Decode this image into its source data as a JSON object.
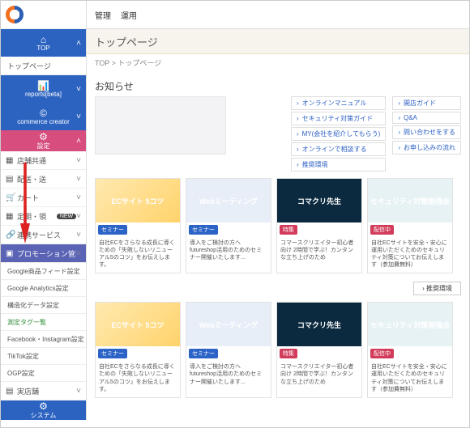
{
  "topbar": {
    "t1": "管理",
    "t2": "運用"
  },
  "page": {
    "title": "トップページ",
    "crumb": "TOP > トップページ"
  },
  "sidebar": {
    "logo": "F",
    "logoText": "",
    "top": "TOP",
    "toppage": "トップページ",
    "reports": "reports[beta]",
    "commerce": "commerce creator",
    "settings": "設定",
    "gray": [
      "店舗共通",
      "配送・送",
      "カート",
      "定期・領",
      "連携サービス"
    ],
    "badge": "NEW",
    "promo": "プロモーション管理",
    "subs": [
      "Google商品フィード設定",
      "Google Analytics設定",
      "構造化データ設定",
      "測定タグ一覧",
      "Facebook・Instagram設定",
      "TikTok設定",
      "OGP設定"
    ],
    "store": "実店舗",
    "system": "システム"
  },
  "notice": {
    "title": "お知らせ"
  },
  "links1": [
    "オンラインマニュアル",
    "セキュリティ対策ガイド",
    "MY(会社を紹介してもらう)",
    "オンラインで相談する",
    "推奨環境"
  ],
  "links2": [
    "開店ガイド",
    "Q&A",
    "問い合わせをする",
    "お申し込みの流れ"
  ],
  "cards": [
    {
      "thumb": "ECサイト 5コツ",
      "chip": "セミナー",
      "chipCls": "sem",
      "desc": "自社ECをさらなる成長に導くための「失敗しないリニューアル5のコツ」をお伝えします。",
      "tCls": "t1"
    },
    {
      "thumb": "Webミーティング",
      "chip": "セミナー",
      "chipCls": "sem",
      "desc": "導入をご検討の方へ futureshop活用のためのセミナー開催いたします...",
      "tCls": "t2"
    },
    {
      "thumb": "コマクリ先生",
      "chip": "特集",
      "chipCls": "sp",
      "desc": "コマースクリエイター初心者向け 2時間で学ぶ！カンタンな立ち上げのため",
      "tCls": "t3"
    },
    {
      "thumb": "セキュリティ対策勉強会",
      "chip": "配信中",
      "chipCls": "sp",
      "desc": "自社ECサイトを安全・安心に運用いただくためのセキュリティ対策についてお伝えします（参加費無料）",
      "tCls": "t4"
    }
  ],
  "rec": "推奨環境"
}
